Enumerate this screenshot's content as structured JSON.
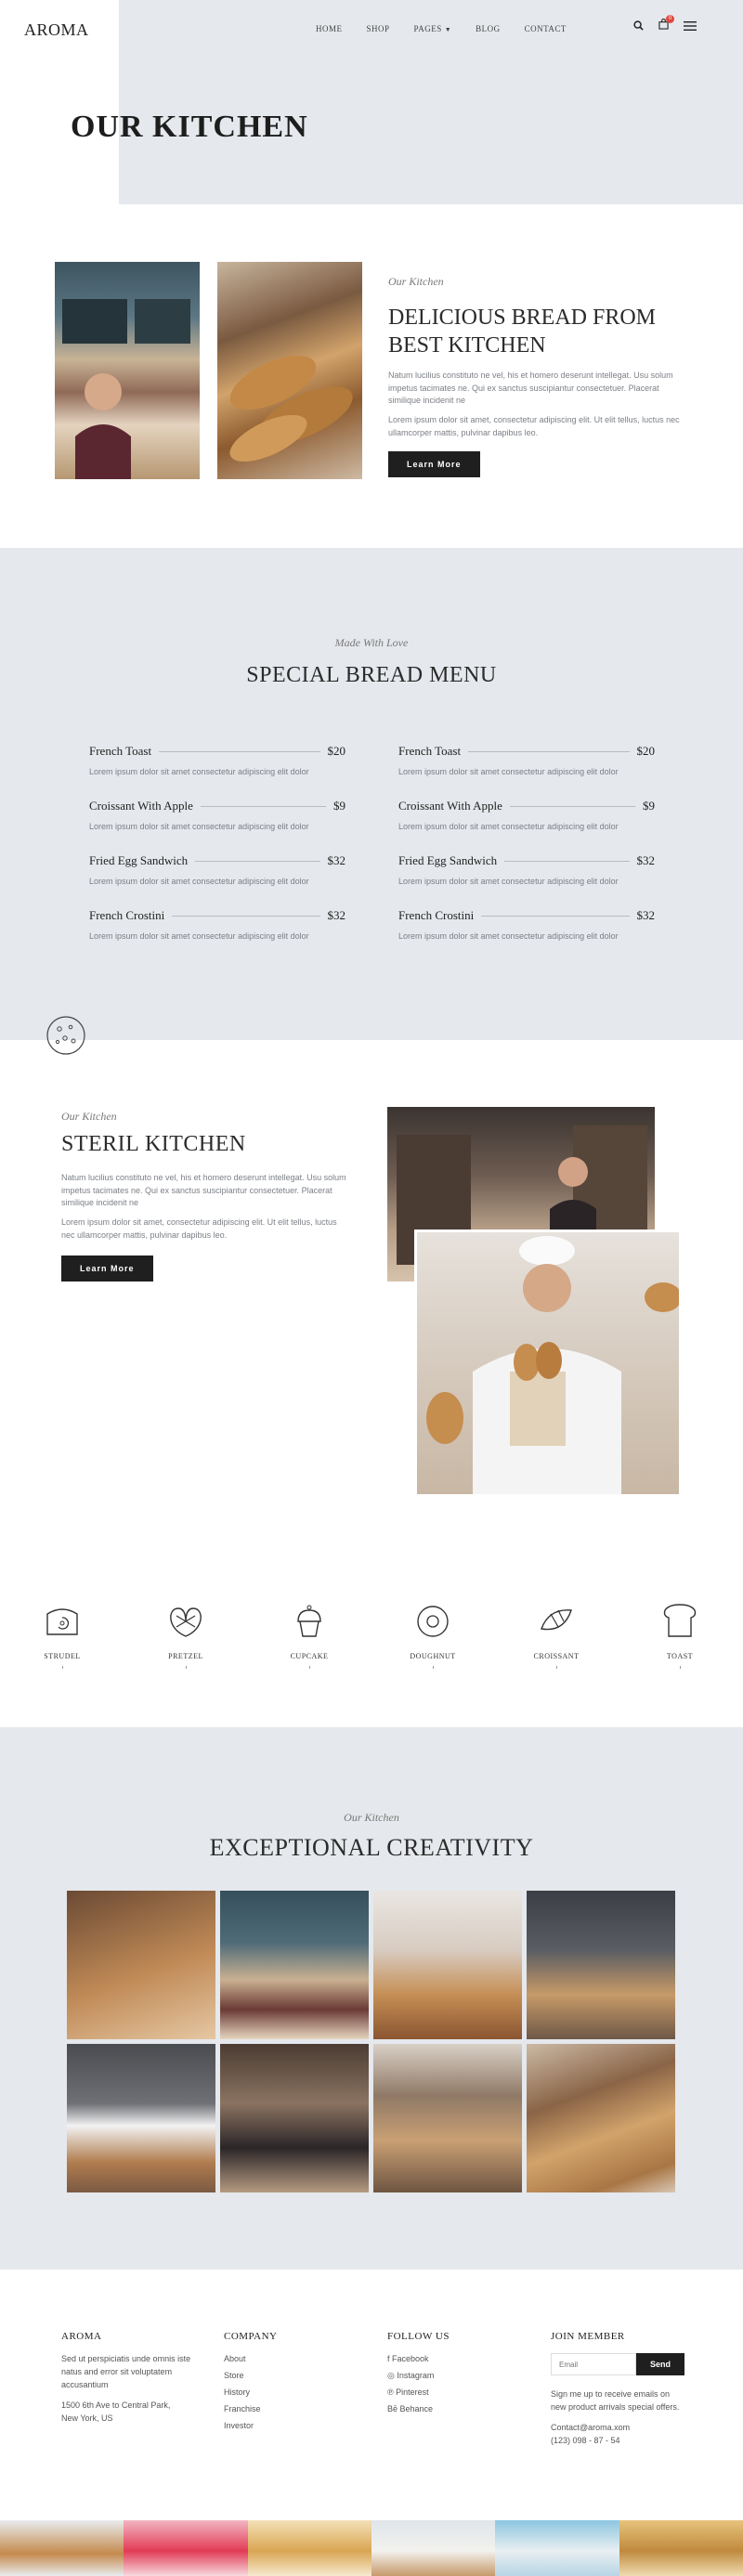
{
  "header": {
    "logo": "AROMA",
    "nav": [
      {
        "label": "HOME"
      },
      {
        "label": "SHOP"
      },
      {
        "label": "PAGES"
      },
      {
        "label": "BLOG"
      },
      {
        "label": "CONTACT"
      }
    ],
    "cart_count": "0",
    "page_title": "OUR KITCHEN"
  },
  "about": {
    "eyebrow": "Our Kitchen",
    "title": "DELICIOUS BREAD FROM BEST KITCHEN",
    "para1": "Natum lucilius constituto ne vel, his et homero deserunt intellegat. Usu solum impetus tacimates ne. Qui ex sanctus suscipiantur consectetuer. Placerat similique incidenit ne",
    "para2": "Lorem ipsum dolor sit amet, consectetur adipiscing elit. Ut elit tellus, luctus nec ullamcorper mattis, pulvinar dapibus leo.",
    "button": "Learn More"
  },
  "menu": {
    "eyebrow": "Made With Love",
    "title": "SPECIAL BREAD MENU",
    "items_left": [
      {
        "name": "French Toast",
        "price": "$20",
        "desc": "Lorem ipsum dolor sit amet consectetur adipiscing elit dolor"
      },
      {
        "name": "Croissant With Apple",
        "price": "$9",
        "desc": "Lorem ipsum dolor sit amet consectetur adipiscing elit dolor"
      },
      {
        "name": "Fried Egg Sandwich",
        "price": "$32",
        "desc": "Lorem ipsum dolor sit amet consectetur adipiscing elit dolor"
      },
      {
        "name": "French Crostini",
        "price": "$32",
        "desc": "Lorem ipsum dolor sit amet consectetur adipiscing elit dolor"
      }
    ],
    "items_right": [
      {
        "name": "French Toast",
        "price": "$20",
        "desc": "Lorem ipsum dolor sit amet consectetur adipiscing elit dolor"
      },
      {
        "name": "Croissant With Apple",
        "price": "$9",
        "desc": "Lorem ipsum dolor sit amet consectetur adipiscing elit dolor"
      },
      {
        "name": "Fried Egg Sandwich",
        "price": "$32",
        "desc": "Lorem ipsum dolor sit amet consectetur adipiscing elit dolor"
      },
      {
        "name": "French Crostini",
        "price": "$32",
        "desc": "Lorem ipsum dolor sit amet consectetur adipiscing elit dolor"
      }
    ]
  },
  "steril": {
    "eyebrow": "Our Kitchen",
    "title": "STERIL KITCHEN",
    "para1": "Natum lucilius constituto ne vel, his et homero deserunt intellegat. Usu solum impetus tacimates ne. Qui ex sanctus suscipiantur consectetuer. Placerat similique incidenit ne",
    "para2": "Lorem ipsum dolor sit amet, consectetur adipiscing elit. Ut elit tellus, luctus nec ullamcorper mattis, pulvinar dapibus leo.",
    "button": "Learn More"
  },
  "categories": [
    {
      "label": "STRUDEL",
      "icon": "strudel-icon"
    },
    {
      "label": "PRETZEL",
      "icon": "pretzel-icon"
    },
    {
      "label": "CUPCAKE",
      "icon": "cupcake-icon"
    },
    {
      "label": "DOUGHNUT",
      "icon": "doughnut-icon"
    },
    {
      "label": "CROISSANT",
      "icon": "croissant-icon"
    },
    {
      "label": "TOAST",
      "icon": "toast-icon"
    }
  ],
  "gallery": {
    "eyebrow": "Our Kitchen",
    "title": "EXCEPTIONAL CREATIVITY"
  },
  "footer": {
    "aroma": {
      "title": "AROMA",
      "text": "Sed ut perspiciatis unde omnis iste natus and error sit voluptatem accusantium",
      "address": "1500 6th Ave to Central Park, New York, US"
    },
    "company": {
      "title": "COMPANY",
      "links": [
        "About",
        "Store",
        "History",
        "Franchise",
        "Investor"
      ]
    },
    "follow": {
      "title": "FOLLOW US",
      "links": [
        "Facebook",
        "Instagram",
        "Pinterest",
        "Behance"
      ]
    },
    "join": {
      "title": "JOIN MEMBER",
      "placeholder": "Email",
      "button": "Send",
      "text": "Sign me up to receive emails on new product arrivals special offers.",
      "email": "Contact@aroma.xom",
      "phone": "(123) 098 - 87 - 54"
    }
  },
  "colors": {
    "section_bg": "#e5e8ec",
    "dark": "#1f1f1f",
    "badge": "#e0483f"
  }
}
